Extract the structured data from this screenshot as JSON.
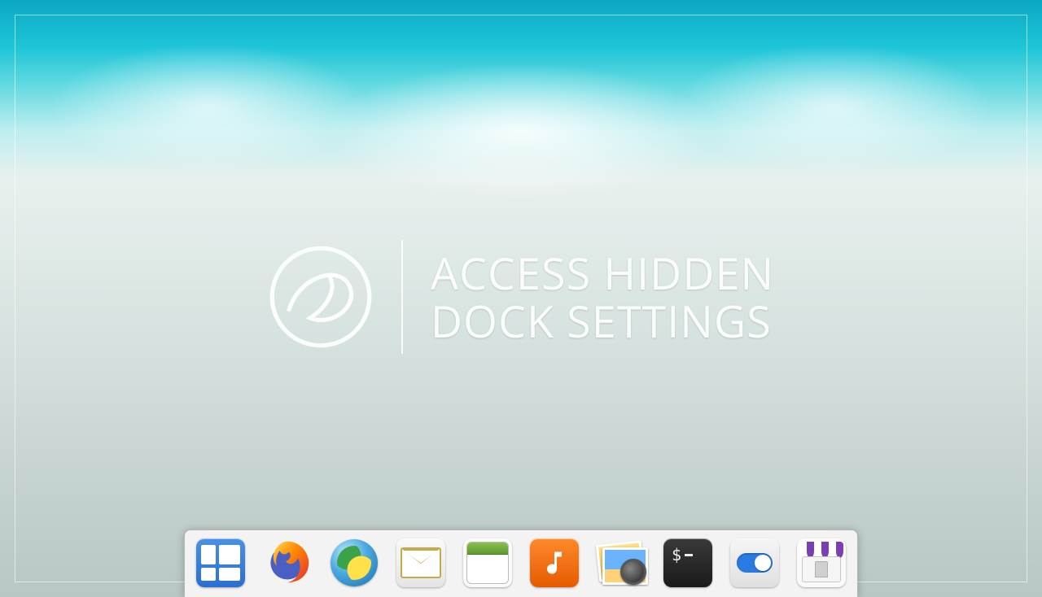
{
  "hero": {
    "line1": "ACCESS HIDDEN",
    "line2": "DOCK SETTINGS"
  },
  "dock": {
    "items": [
      {
        "name": "Multitasking View",
        "icon": "multitasking-icon"
      },
      {
        "name": "Firefox",
        "icon": "firefox-icon"
      },
      {
        "name": "Web Browser",
        "icon": "globe-icon"
      },
      {
        "name": "Mail",
        "icon": "mail-icon"
      },
      {
        "name": "Calendar",
        "icon": "calendar-icon"
      },
      {
        "name": "Music",
        "icon": "music-icon"
      },
      {
        "name": "Photos",
        "icon": "photos-icon"
      },
      {
        "name": "Terminal",
        "icon": "terminal-icon"
      },
      {
        "name": "System Settings",
        "icon": "settings-icon"
      },
      {
        "name": "AppCenter",
        "icon": "appcenter-icon"
      }
    ]
  }
}
